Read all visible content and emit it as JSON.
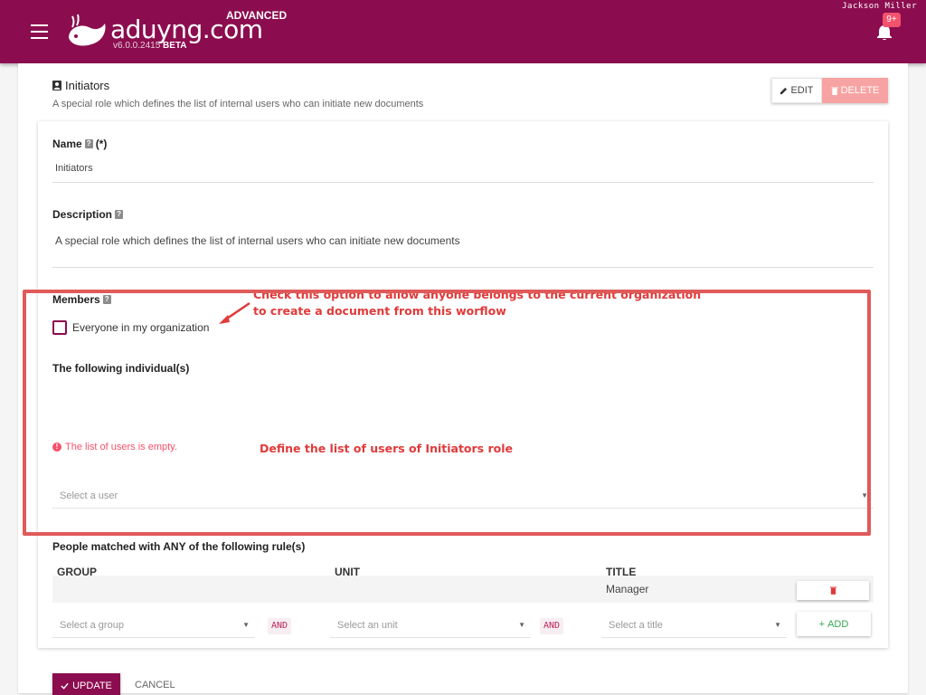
{
  "header": {
    "app_name": "aduyng.com",
    "edition": "ADVANCED",
    "version": "v6.0.0.2415",
    "version_tag": "BETA",
    "user_name": "Jackson Miller",
    "notifications_badge": "9+",
    "brand_color": "#8c0d4f",
    "icons": [
      "menu-icon",
      "whale-logo-icon",
      "bell-icon"
    ]
  },
  "role": {
    "title": "Initiators",
    "description": "A special role which defines the list of internal users who can initiate new documents",
    "edit_label": "EDIT",
    "delete_label": "DELETE"
  },
  "form": {
    "name_label": "Name",
    "name_required": "(*)",
    "name_value": "Initiators",
    "description_label": "Description",
    "description_value": "A special role which defines the list of internal users who can initiate new documents",
    "members_label": "Members",
    "everyone_label": "Everyone in my organization",
    "everyone_checked": false,
    "individuals_label": "The following individual(s)",
    "individuals_error": "The list of users is empty.",
    "user_select_placeholder": "Select a user",
    "rules_label": "People matched with ANY of the following rule(s)",
    "columns": [
      "GROUP",
      "UNIT",
      "TITLE"
    ],
    "rows": [
      {
        "group": "",
        "unit": "",
        "title": "Manager"
      }
    ],
    "group_placeholder": "Select a group",
    "unit_placeholder": "Select an unit",
    "title_placeholder": "Select a title",
    "and_label": "AND",
    "add_label": "ADD",
    "update_label": "UPDATE",
    "cancel_label": "CANCEL"
  },
  "annotations": {
    "everyone_note_line1": "Check this option to allow anyone belongs to the current organization",
    "everyone_note_line2": "to create a document from this worflow",
    "individuals_note": "Define the list of users of Initiators role",
    "annotation_color": "#e03a3a"
  }
}
